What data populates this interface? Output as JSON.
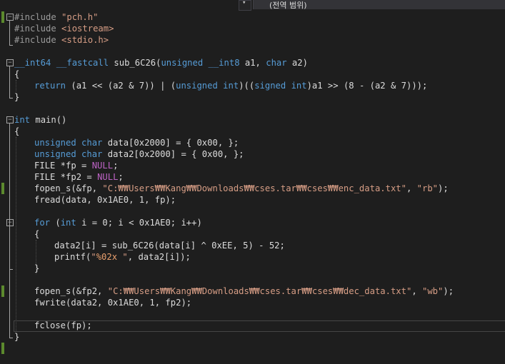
{
  "scope_bar": {
    "label": "(전역 범위)",
    "arrow": "▾"
  },
  "code_lines": [
    [
      "#include ",
      "\"pch.h\""
    ],
    [
      "#include ",
      "<iostream>"
    ],
    [
      "#include ",
      "<stdio.h>"
    ],
    [],
    [
      "__int64 __fastcall ",
      "sub_6C26(",
      "unsigned __int8 ",
      "a1, ",
      "char ",
      "a2)"
    ],
    [
      "{"
    ],
    [
      "return ",
      "(a1 << (a2 & 7)) | (",
      "unsigned int",
      ")((",
      "signed int",
      ")a1 >> (8 - (a2 & 7)));"
    ],
    [
      "}"
    ],
    [],
    [
      "int ",
      "main()"
    ],
    [
      "{"
    ],
    [
      "unsigned char ",
      "data[0x2000] = { 0x00, };"
    ],
    [
      "unsigned char ",
      "data2[0x2000] = { 0x00, };"
    ],
    [
      "FILE *fp = ",
      "NULL",
      ";"
    ],
    [
      "FILE *fp2 = ",
      "NULL",
      ";"
    ],
    [
      "fopen_s(&fp, ",
      "\"C:₩₩Users₩₩Kang₩₩Downloads₩₩cses.tar₩₩cses₩₩enc_data.txt\"",
      ", ",
      "\"rb\"",
      ");"
    ],
    [
      "fread(data, 0x1AE0, 1, fp);"
    ],
    [],
    [
      "for ",
      "(",
      "int ",
      "i = 0; i < 0x1AE0; i++)"
    ],
    [
      "{"
    ],
    [
      "data2[i] = sub_6C26(data[i] ^ 0xEE, 5) - 52;"
    ],
    [
      "printf(",
      "\"",
      "%02x",
      " \"",
      ", data2[i]);"
    ],
    [
      "}"
    ],
    [],
    [
      "fopen_s(&fp2, ",
      "\"C:₩₩Users₩₩Kang₩₩Downloads₩₩cses.tar₩₩cses₩₩dec_data.txt\"",
      ", ",
      "\"wb\"",
      ");"
    ],
    [
      "fwrite(data2, 0x1AE0, 1, fp2);"
    ],
    [],
    [
      "fclose(fp);"
    ],
    [
      "}"
    ]
  ],
  "colors": {
    "background": "#1e1e1e",
    "keyword": "#569cd6",
    "string": "#d69d85",
    "macro": "#bd63c5",
    "preprocessor": "#9b9b9b",
    "change_marker": "#5c8a2d"
  },
  "icons": [
    "fold-collapse-icon",
    "dropdown-arrow-icon"
  ]
}
